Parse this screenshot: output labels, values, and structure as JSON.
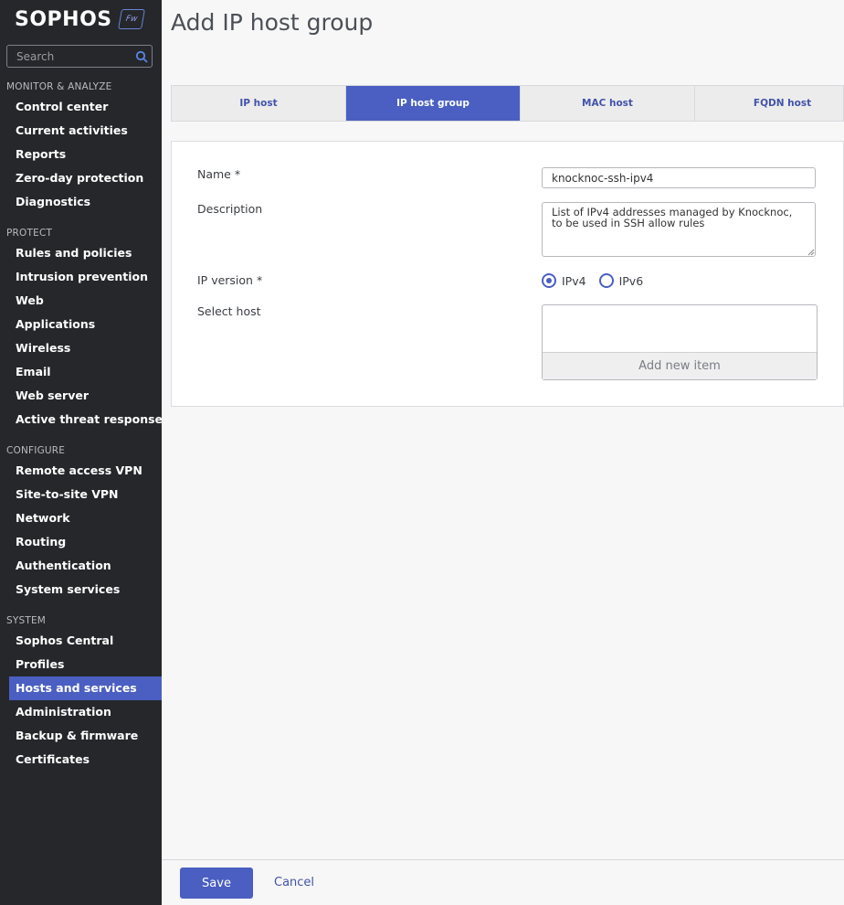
{
  "brand": {
    "name": "SOPHOS",
    "badge": "Fw"
  },
  "search": {
    "placeholder": "Search"
  },
  "sidebar": {
    "sections": [
      {
        "title": "MONITOR & ANALYZE",
        "items": [
          "Control center",
          "Current activities",
          "Reports",
          "Zero-day protection",
          "Diagnostics"
        ]
      },
      {
        "title": "PROTECT",
        "items": [
          "Rules and policies",
          "Intrusion prevention",
          "Web",
          "Applications",
          "Wireless",
          "Email",
          "Web server",
          "Active threat response"
        ]
      },
      {
        "title": "CONFIGURE",
        "items": [
          "Remote access VPN",
          "Site-to-site VPN",
          "Network",
          "Routing",
          "Authentication",
          "System services"
        ]
      },
      {
        "title": "SYSTEM",
        "items": [
          "Sophos Central",
          "Profiles",
          "Hosts and services",
          "Administration",
          "Backup & firmware",
          "Certificates"
        ]
      }
    ],
    "active_item": "Hosts and services"
  },
  "page": {
    "title": "Add IP host group"
  },
  "tabs": [
    {
      "label": "IP host",
      "active": false
    },
    {
      "label": "IP host group",
      "active": true
    },
    {
      "label": "MAC host",
      "active": false
    },
    {
      "label": "FQDN host",
      "active": false
    }
  ],
  "form": {
    "name_label": "Name *",
    "name_value": "knocknoc-ssh-ipv4",
    "description_label": "Description",
    "description_value": "List of IPv4 addresses managed by Knocknoc, to be used in SSH allow rules",
    "ip_version_label": "IP version *",
    "ip_versions": [
      {
        "label": "IPv4",
        "selected": true
      },
      {
        "label": "IPv6",
        "selected": false
      }
    ],
    "select_host_label": "Select host",
    "add_new_item": "Add new item"
  },
  "footer": {
    "save": "Save",
    "cancel": "Cancel"
  },
  "colors": {
    "sidebar_bg": "#25272b",
    "accent": "#4a5fc1",
    "link": "#4253a8"
  }
}
